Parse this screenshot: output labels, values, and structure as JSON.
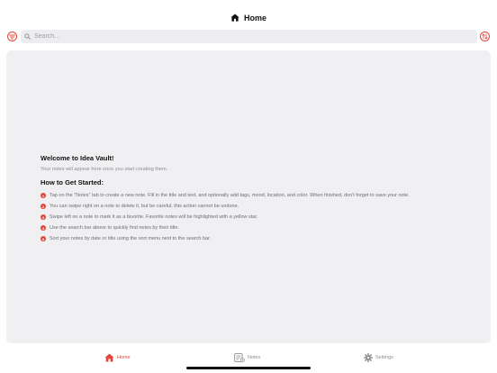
{
  "header": {
    "title": "Home",
    "icon": "house-icon"
  },
  "search": {
    "placeholder": "Search..."
  },
  "welcome": {
    "title": "Welcome to Idea Vault!",
    "subtitle": "Your notes will appear here once you start creating them.",
    "how_to_title": "How to Get Started:",
    "steps": [
      {
        "number": "1",
        "text": "Tap on the \"Notes\" tab to create a new note. Fill in the title and text, and optionally add tags, mood, location, and color. When finished, don't forget to save your note."
      },
      {
        "number": "2",
        "text": "You can swipe right on a note to delete it, but be careful, this action cannot be undone."
      },
      {
        "number": "3",
        "text": "Swipe left on a note to mark it as a favorite. Favorite notes will be highlighted with a yellow star."
      },
      {
        "number": "4",
        "text": "Use the search bar above to quickly find notes by their title."
      },
      {
        "number": "5",
        "text": "Sort your notes by date or title using the sort menu next to the search bar."
      }
    ]
  },
  "tabs": [
    {
      "label": "Home",
      "icon": "house-icon",
      "active": true
    },
    {
      "label": "Notes",
      "icon": "notes-icon",
      "active": false
    },
    {
      "label": "Settings",
      "icon": "gear-icon",
      "active": false
    }
  ],
  "colors": {
    "accent": "#e2463a",
    "background": "#f0f0f2",
    "muted": "#8e8e93"
  }
}
